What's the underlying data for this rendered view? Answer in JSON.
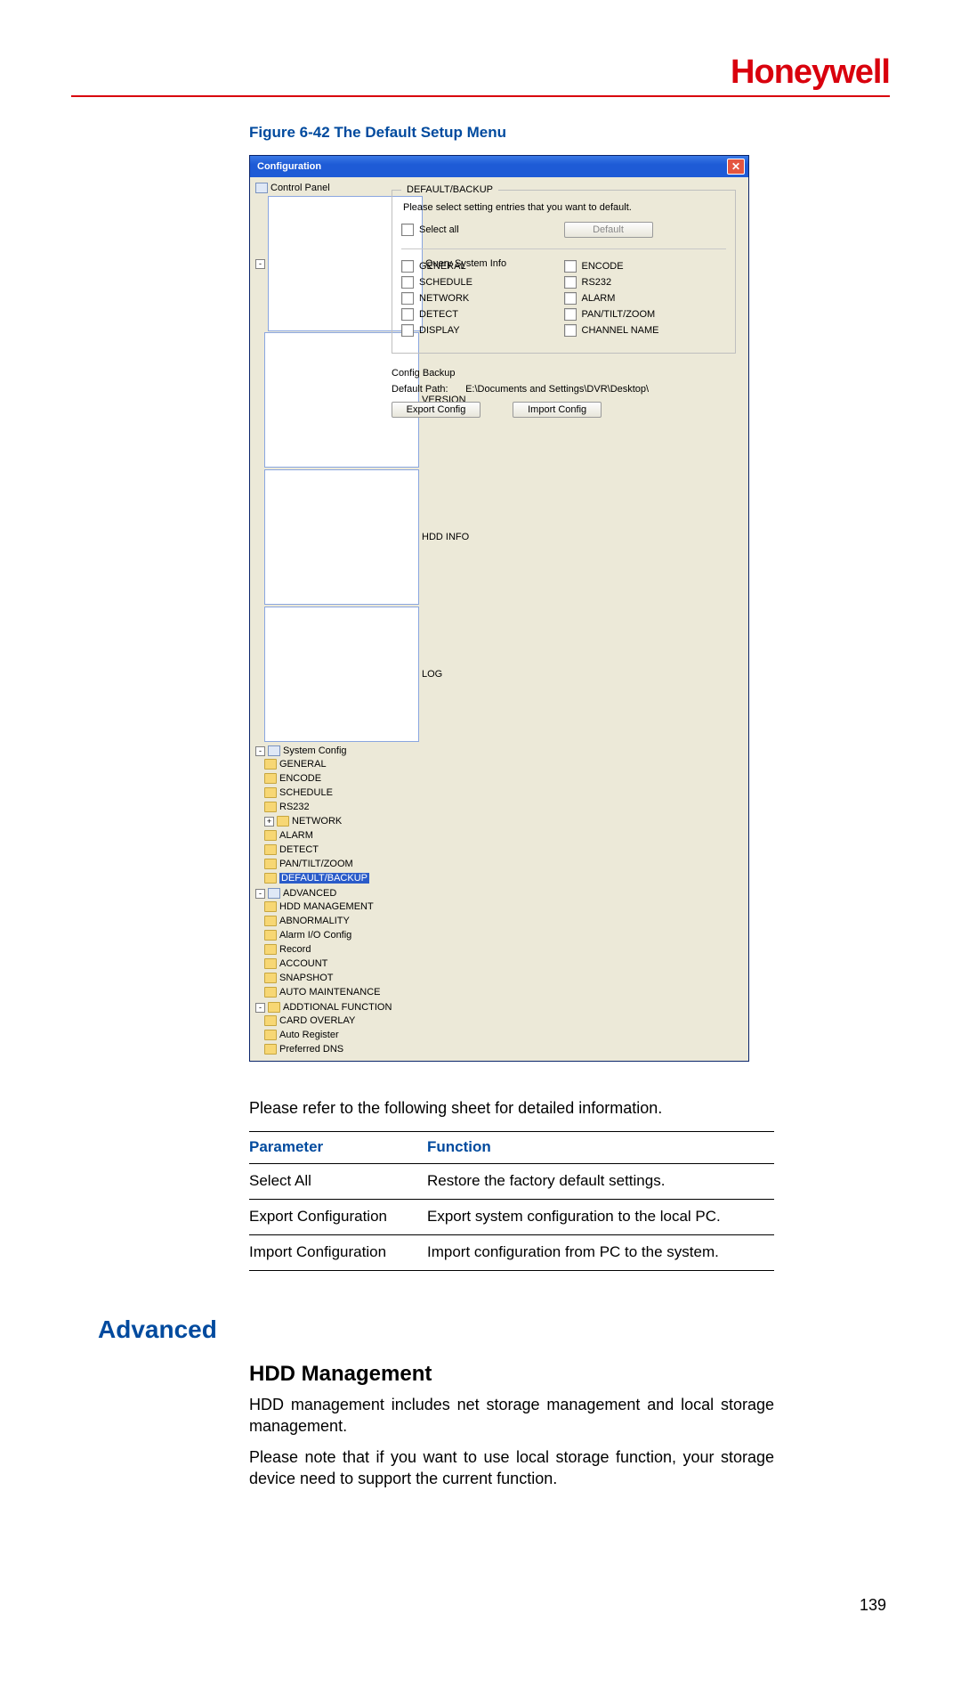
{
  "brand": "Honeywell",
  "figure_caption": "Figure 6-42 The Default Setup Menu",
  "window": {
    "title": "Configuration",
    "tree": {
      "root": "Control Panel",
      "query": "Query System Info",
      "query_items": [
        "VERSION",
        "HDD INFO",
        "LOG"
      ],
      "sys": "System Config",
      "sys_items": [
        "GENERAL",
        "ENCODE",
        "SCHEDULE",
        "RS232",
        "NETWORK",
        "ALARM",
        "DETECT",
        "PAN/TILT/ZOOM",
        "DEFAULT/BACKUP"
      ],
      "adv": "ADVANCED",
      "adv_items": [
        "HDD MANAGEMENT",
        "ABNORMALITY",
        "Alarm I/O Config",
        "Record",
        "ACCOUNT",
        "SNAPSHOT",
        "AUTO MAINTENANCE"
      ],
      "add": "ADDTIONAL FUNCTION",
      "add_items": [
        "CARD OVERLAY",
        "Auto Register",
        "Preferred DNS"
      ]
    },
    "panel": {
      "group_title": "DEFAULT/BACKUP",
      "hint": "Please select setting entries that you want to default.",
      "select_all": "Select all",
      "default_btn": "Default",
      "opts_left": [
        "GENERAL",
        "SCHEDULE",
        "NETWORK",
        "DETECT",
        "DISPLAY"
      ],
      "opts_right": [
        "ENCODE",
        "RS232",
        "ALARM",
        "PAN/TILT/ZOOM",
        "CHANNEL NAME"
      ],
      "backup_label": "Config Backup",
      "path_label": "Default Path:",
      "path_value": "E:\\Documents and Settings\\DVR\\Desktop\\",
      "export_btn": "Export Config",
      "import_btn": "Import Config"
    }
  },
  "body_lead": "Please refer to the following sheet for detailed information.",
  "table": {
    "h1": "Parameter",
    "h2": "Function",
    "rows": [
      {
        "p": "Select All",
        "f": "Restore the factory default settings."
      },
      {
        "p": "Export Configuration",
        "f": "Export system configuration to the local PC."
      },
      {
        "p": "Import Configuration",
        "f": "Import configuration from PC to the system."
      }
    ]
  },
  "section": "Advanced",
  "subsection": "HDD Management",
  "para1": "HDD management includes net storage management and local storage management.",
  "para2": "Please note that if you want to use local storage function, your storage device need to support the current function.",
  "page_number": "139"
}
